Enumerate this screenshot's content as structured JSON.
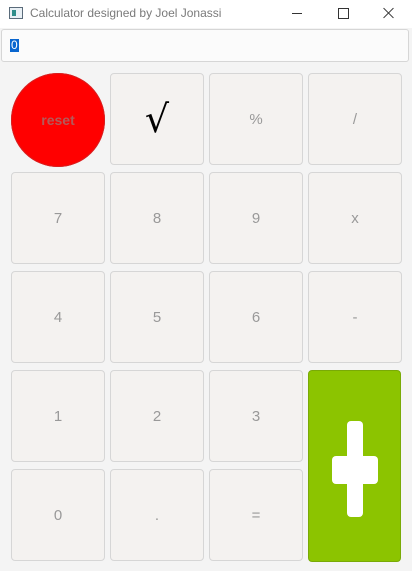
{
  "window": {
    "title": "Calculator designed by Joel Jonassi",
    "controls": [
      "minimize-icon",
      "maximize-icon",
      "close-icon"
    ]
  },
  "display": {
    "value": "0"
  },
  "buttons": {
    "reset": "reset",
    "sqrt": "√",
    "percent": "%",
    "divide": "/",
    "seven": "7",
    "eight": "8",
    "nine": "9",
    "multiply": "x",
    "four": "4",
    "five": "5",
    "six": "6",
    "minus": "-",
    "one": "1",
    "two": "2",
    "three": "3",
    "zero": "0",
    "decimal": ".",
    "equals": "="
  },
  "colors": {
    "reset_button": "#ff0000",
    "plus_button": "#8cc400",
    "selection": "#0a66cf"
  }
}
